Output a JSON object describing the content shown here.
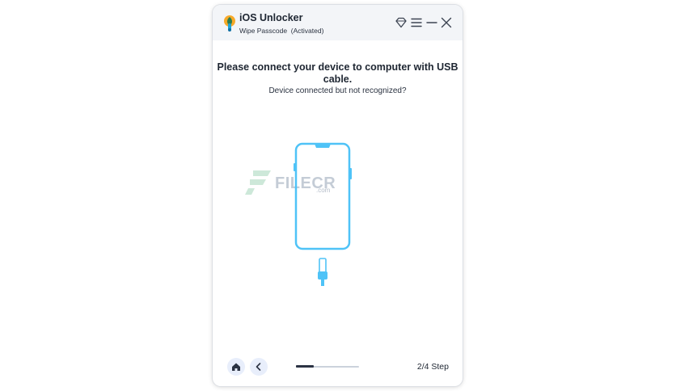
{
  "app": {
    "title": "iOS Unlocker",
    "subtitle": "Wipe Passcode  (Activated)"
  },
  "titlebar": {
    "icons": [
      "diamond-icon",
      "menu-icon",
      "minimize-icon",
      "close-icon"
    ]
  },
  "main": {
    "heading": "Please connect your device to computer with USB cable.",
    "help_link": "Device connected but not recognized?"
  },
  "watermark": {
    "text": "FILECR",
    "sub": ".com"
  },
  "footer": {
    "icons": [
      "home-icon",
      "chevron-left-icon"
    ],
    "progress": 0.28,
    "step_label": "2/4 Step"
  },
  "colors": {
    "accent": "#4fc3f7",
    "text": "#1e2632",
    "titlebar_bg": "#f3f5f8",
    "button_bg": "#e8eefb"
  }
}
